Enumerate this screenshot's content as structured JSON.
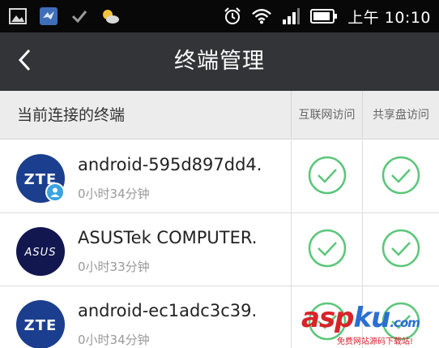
{
  "status_bar": {
    "icons": [
      "gallery-icon",
      "app-bird-icon",
      "check-icon",
      "weather-icon"
    ],
    "right_icons": [
      "alarm-icon",
      "wifi-icon",
      "signal-icon",
      "battery-icon"
    ],
    "time": "上午 10:10"
  },
  "title_bar": {
    "back_icon": "chevron-left-icon",
    "title": "终端管理"
  },
  "header": {
    "label": "当前连接的终端",
    "col_internet": "互联网访问",
    "col_share": "共享盘访问"
  },
  "devices": [
    {
      "logo_text": "ZTE",
      "name": "android-595d897dd4.",
      "connected_time": "0小时34分钟",
      "internet_access": true,
      "share_access": true,
      "has_user_badge": true
    },
    {
      "logo_text": "ASUS",
      "name": "ASUSTek COMPUTER.",
      "connected_time": "0小时33分钟",
      "internet_access": true,
      "share_access": true,
      "has_user_badge": false
    },
    {
      "logo_text": "ZTE",
      "name": "android-ec1adc3c39.",
      "connected_time": "0小时34分钟",
      "internet_access": true,
      "share_access": true,
      "has_user_badge": false
    }
  ],
  "watermark": {
    "logo_red": "asp",
    "logo_blue": "ku",
    "suffix": ".com",
    "tagline": "免费网站源码下载站!"
  },
  "colors": {
    "status_bar_bg": "#080808",
    "title_bar_bg": "#333437",
    "header_bg": "#ececec",
    "check_green": "#5cc67a",
    "zte_blue": "#1b3f8e",
    "asus_navy": "#12174f",
    "badge_blue": "#3aa3e0"
  }
}
